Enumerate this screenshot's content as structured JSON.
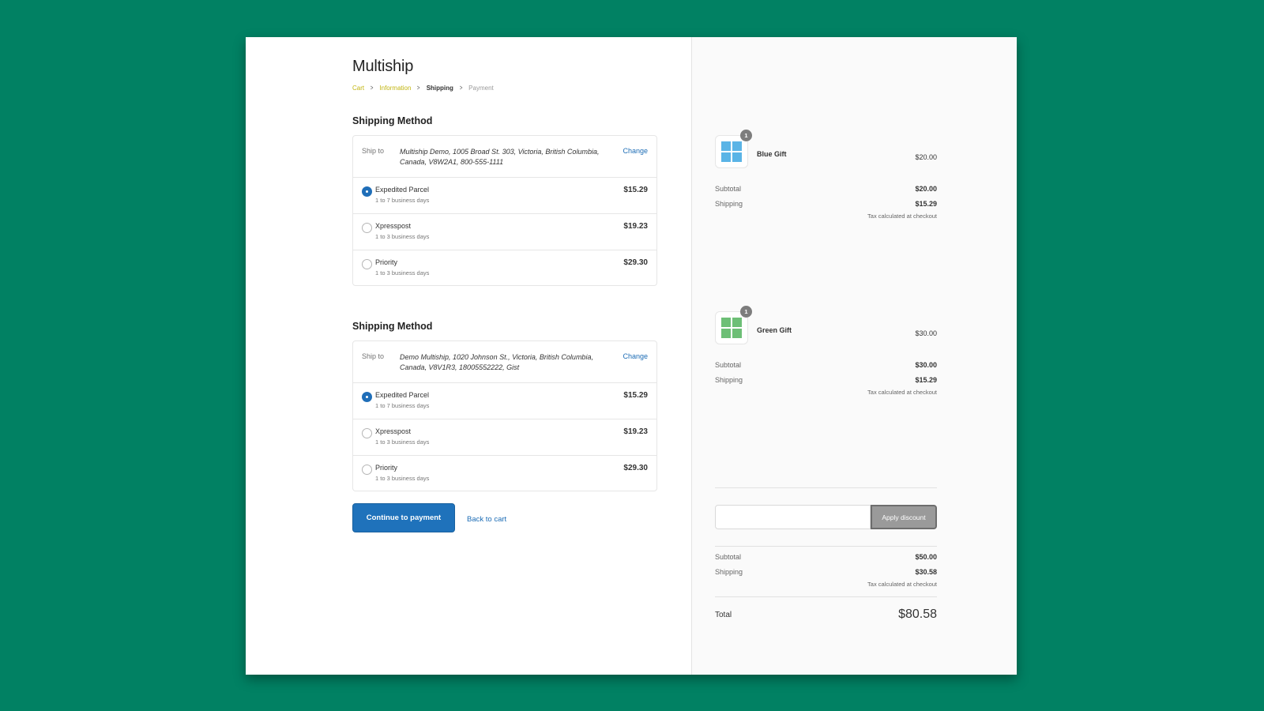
{
  "header": {
    "title": "Multiship",
    "breadcrumb": [
      "Cart",
      "Information",
      "Shipping",
      "Payment"
    ]
  },
  "shipments": [
    {
      "section_title": "Shipping Method",
      "ship_to_label": "Ship to",
      "address": "Multiship Demo, 1005 Broad St. 303, Victoria, British Columbia, Canada, V8W2A1, 800-555-1111",
      "change_label": "Change",
      "rates": [
        {
          "name": "Expedited Parcel",
          "desc": "1 to 7 business days",
          "price": "$15.29",
          "selected": true
        },
        {
          "name": "Xpresspost",
          "desc": "1 to 3 business days",
          "price": "$19.23",
          "selected": false
        },
        {
          "name": "Priority",
          "desc": "1 to 3 business days",
          "price": "$29.30",
          "selected": false
        }
      ]
    },
    {
      "section_title": "Shipping Method",
      "ship_to_label": "Ship to",
      "address": "Demo Multiship, 1020 Johnson St., Victoria, British Columbia, Canada, V8V1R3, 18005552222, Gist",
      "change_label": "Change",
      "rates": [
        {
          "name": "Expedited Parcel",
          "desc": "1 to 7 business days",
          "price": "$15.29",
          "selected": true
        },
        {
          "name": "Xpresspost",
          "desc": "1 to 3 business days",
          "price": "$19.23",
          "selected": false
        },
        {
          "name": "Priority",
          "desc": "1 to 3 business days",
          "price": "$29.30",
          "selected": false
        }
      ]
    }
  ],
  "actions": {
    "continue_label": "Continue to payment",
    "back_label": "Back to cart"
  },
  "summary": {
    "products": [
      {
        "name": "Blue Gift",
        "qty": "1",
        "price": "$20.00",
        "color": "#5ab4e6",
        "subtotal_label": "Subtotal",
        "subtotal": "$20.00",
        "shipping_label": "Shipping",
        "shipping": "$15.29",
        "tax_note": "Tax calculated at checkout"
      },
      {
        "name": "Green Gift",
        "qty": "1",
        "price": "$30.00",
        "color": "#6dbf76",
        "subtotal_label": "Subtotal",
        "subtotal": "$30.00",
        "shipping_label": "Shipping",
        "shipping": "$15.29",
        "tax_note": "Tax calculated at checkout"
      }
    ],
    "discount": {
      "placeholder": "",
      "button_label": "Apply discount"
    },
    "subtotal_label": "Subtotal",
    "subtotal": "$50.00",
    "shipping_label": "Shipping",
    "shipping": "$30.58",
    "tax_note": "Tax calculated at checkout",
    "total_label": "Total",
    "total": "$80.58"
  },
  "colors": {
    "background": "#018163",
    "primary": "#1f72bb",
    "breadcrumb_done": "#c2b510"
  }
}
